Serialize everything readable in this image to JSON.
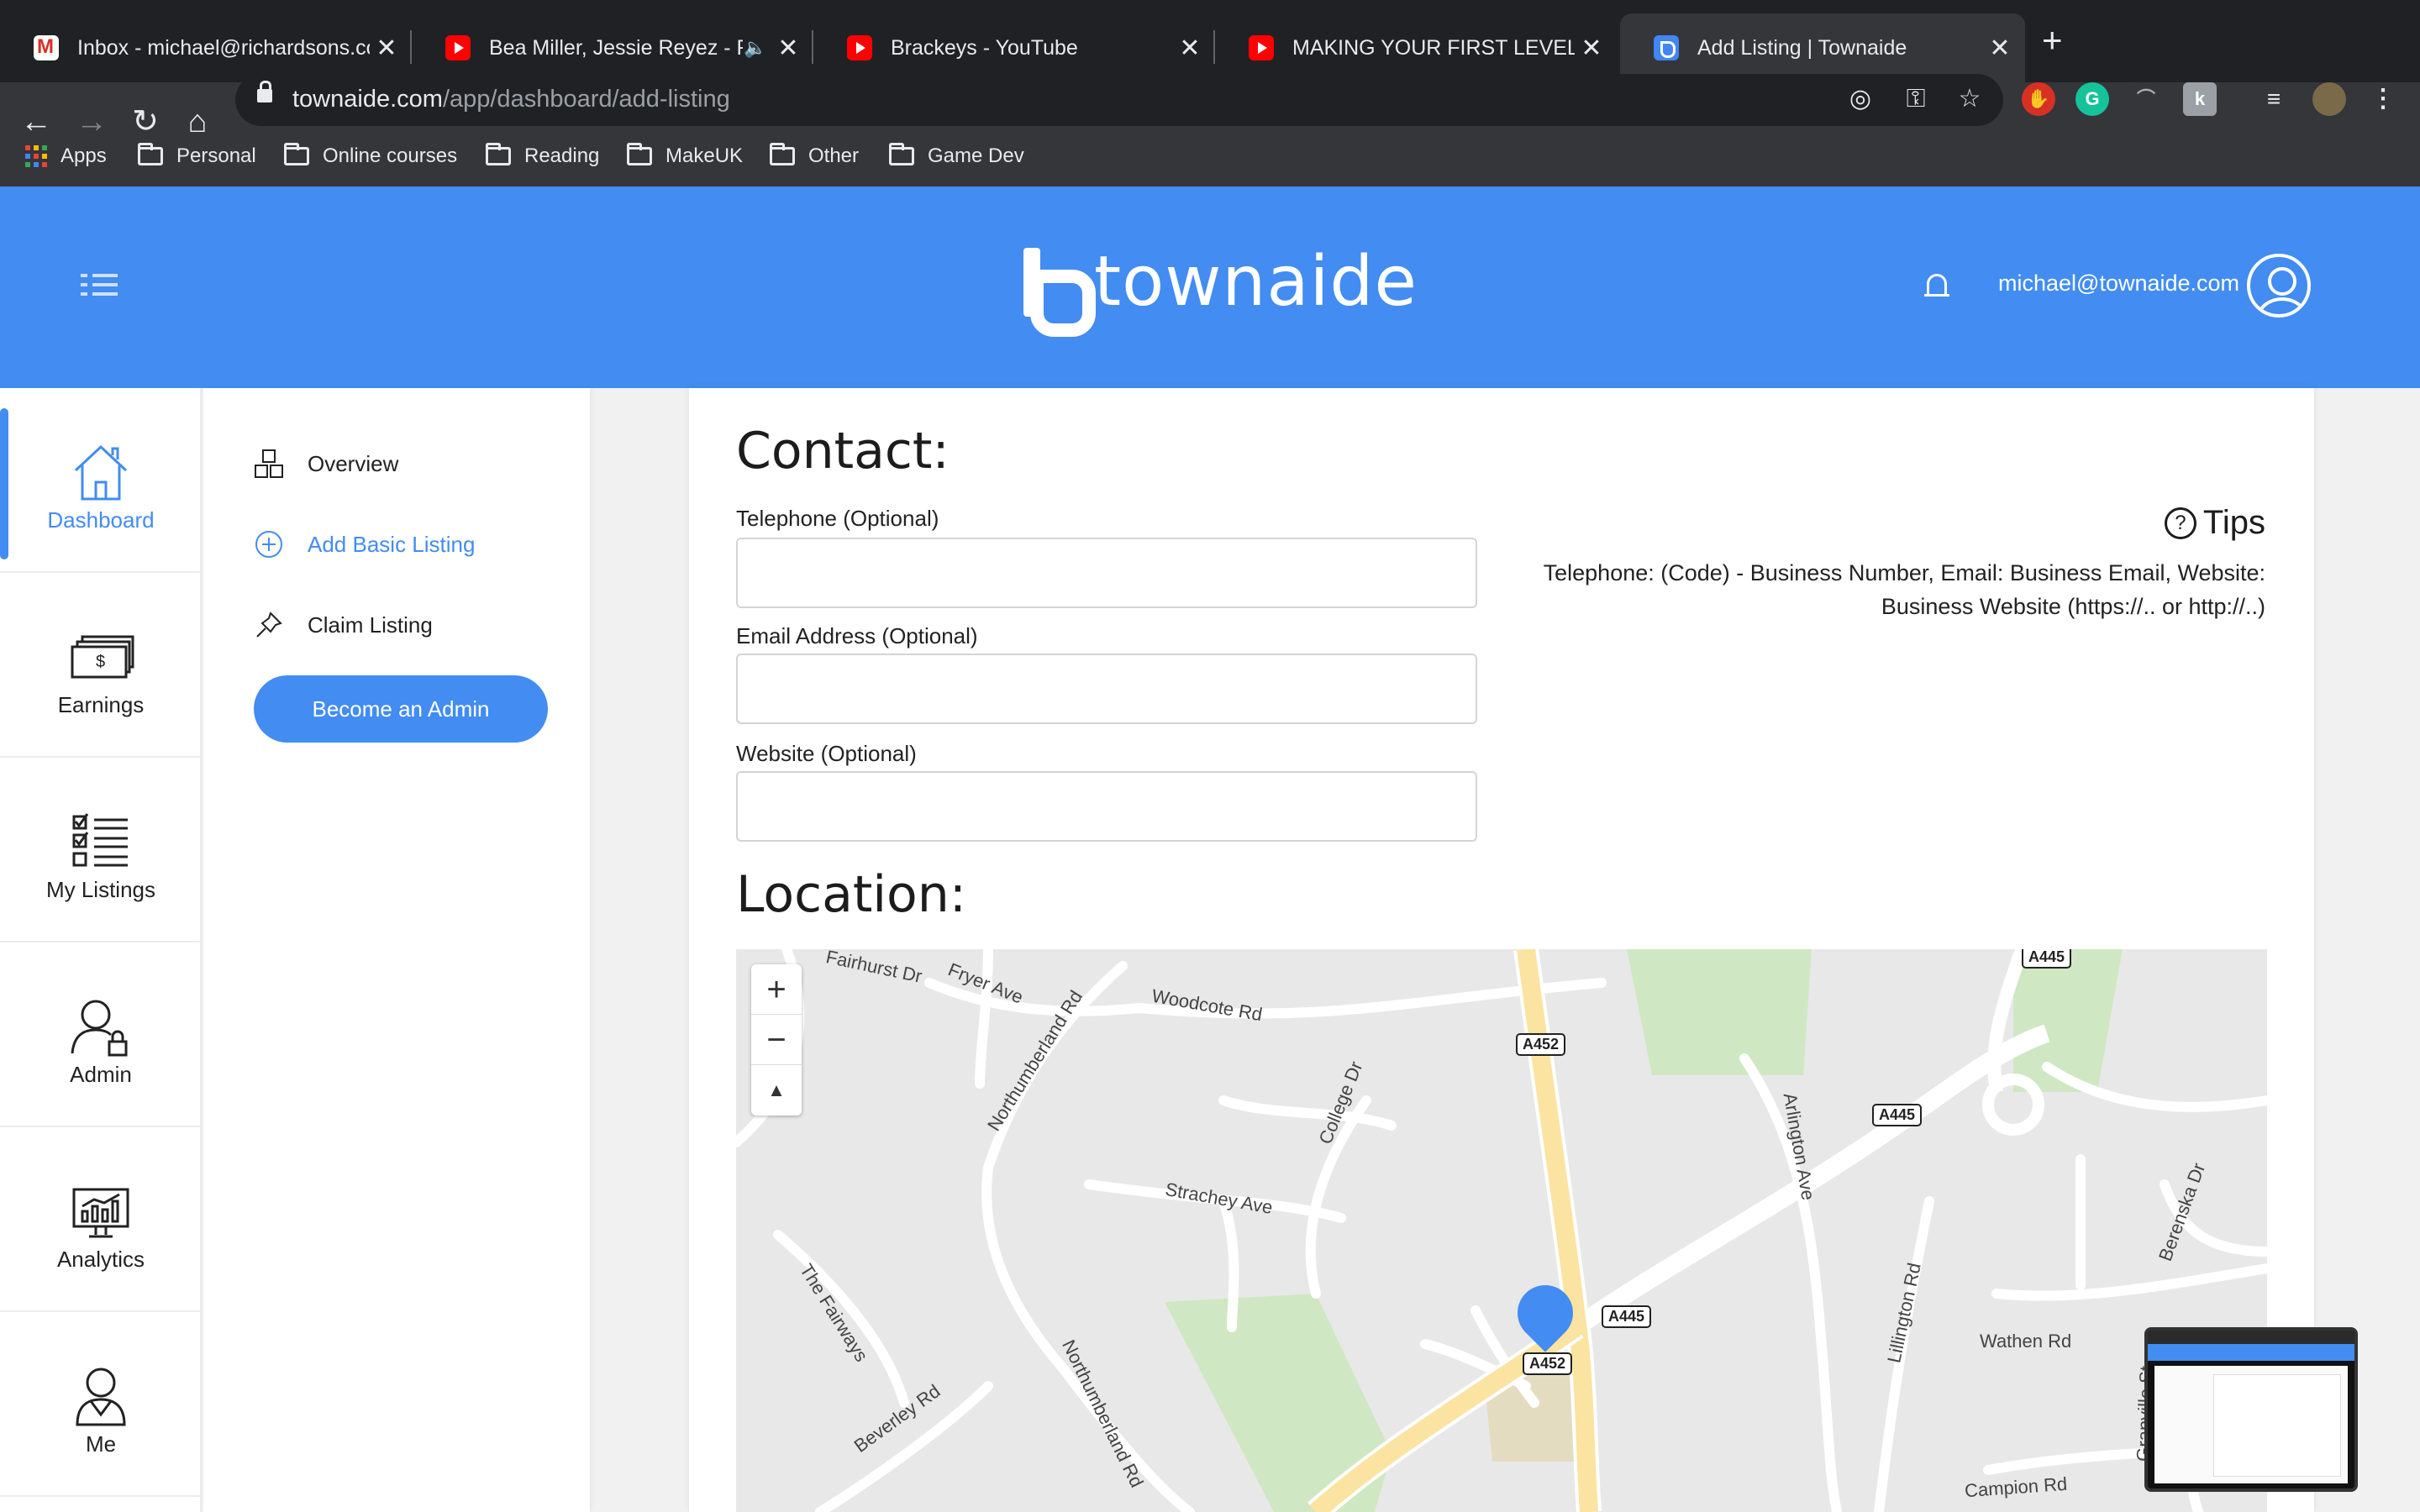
{
  "browser": {
    "tabs": [
      {
        "title": "Inbox - michael@richardsons.co",
        "favicon": "gmail-icon",
        "active": false
      },
      {
        "title": "Bea Miller, Jessie Reyez - FE",
        "favicon": "youtube-icon",
        "active": false,
        "audio": true
      },
      {
        "title": "Brackeys - YouTube",
        "favicon": "youtube-icon",
        "active": false
      },
      {
        "title": "MAKING YOUR FIRST LEVEL in U",
        "favicon": "youtube-icon",
        "active": false
      },
      {
        "title": "Add Listing | Townaide",
        "favicon": "townaide-icon",
        "active": true
      }
    ],
    "url_domain": "townaide.com",
    "url_path": "/app/dashboard/add-listing",
    "bookmarks": [
      "Apps",
      "Personal",
      "Online courses",
      "Reading",
      "MakeUK",
      "Other",
      "Game Dev"
    ]
  },
  "header": {
    "brand": "townaide",
    "user_email": "michael@townaide.com",
    "brand_color": "#428cf2"
  },
  "left_nav": {
    "items": [
      {
        "label": "Dashboard",
        "icon": "house-icon",
        "active": true
      },
      {
        "label": "Earnings",
        "icon": "cash-icon",
        "active": false
      },
      {
        "label": "My Listings",
        "icon": "checklist-icon",
        "active": false
      },
      {
        "label": "Admin",
        "icon": "admin-user-icon",
        "active": false
      },
      {
        "label": "Analytics",
        "icon": "analytics-icon",
        "active": false
      },
      {
        "label": "Me",
        "icon": "person-icon",
        "active": false
      }
    ]
  },
  "sub_menu": {
    "items": [
      {
        "label": "Overview",
        "icon": "blocks-icon",
        "active": false
      },
      {
        "label": "Add Basic Listing",
        "icon": "plus-circle-icon",
        "active": true
      },
      {
        "label": "Claim Listing",
        "icon": "pin-icon",
        "active": false
      }
    ],
    "admin_button": "Become an Admin"
  },
  "form": {
    "contact_title": "Contact:",
    "telephone_label": "Telephone (Optional)",
    "telephone_value": "",
    "email_label": "Email Address (Optional)",
    "email_value": "",
    "website_label": "Website (Optional)",
    "website_value": "",
    "tips_title": "Tips",
    "tips_text": "Telephone: (Code) - Business Number, Email: Business Email, Website: Business Website (https://.. or http://..)",
    "location_title": "Location:"
  },
  "map": {
    "zoom_in": "+",
    "zoom_out": "−",
    "compass": "▲",
    "road_labels": [
      "Fairhurst Dr",
      "Fryer Ave",
      "Woodcote Rd",
      "Northumberland Rd",
      "College Dr",
      "Strachey Ave",
      "Arlington Ave",
      "Berenska Dr",
      "Lillington Rd",
      "Wathen Rd",
      "Granville St",
      "Campion Rd",
      "The Fairways",
      "Beverley Rd",
      "Northumberland Rd"
    ],
    "shields": [
      "A445",
      "A452",
      "A445",
      "A445",
      "A452"
    ]
  }
}
